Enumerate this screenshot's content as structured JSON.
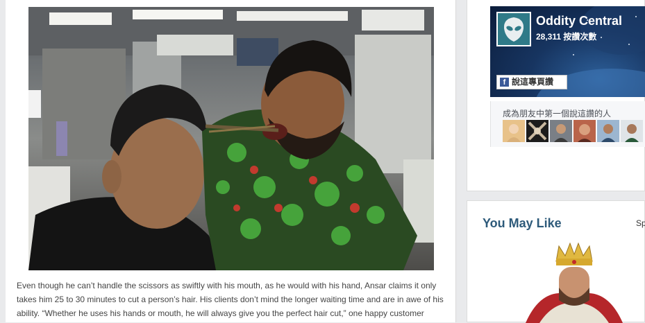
{
  "article": {
    "paragraph": "Even though he can’t handle the scissors as swiftly with his mouth, as he would with his hand, Ansar claims it only takes him 25 to 30 minutes to cut a person’s hair. His clients don’t mind the longer waiting time and are in awe of his ability. “Whether he uses his hands or mouth, he will always give you the perfect hair cut,” one happy customer"
  },
  "facebook_widget": {
    "page_name": "Oddity Central",
    "likes": "28,311 按讚次數",
    "like_button": "說這專頁讚",
    "fb_glyph": "f",
    "friends_prompt": "成為朋友中第一個說這讚的人",
    "brand_color": "#3b5998"
  },
  "recommendations": {
    "title": "You May Like",
    "sponsored": "Sp",
    "title_color": "#2d5a7a"
  }
}
